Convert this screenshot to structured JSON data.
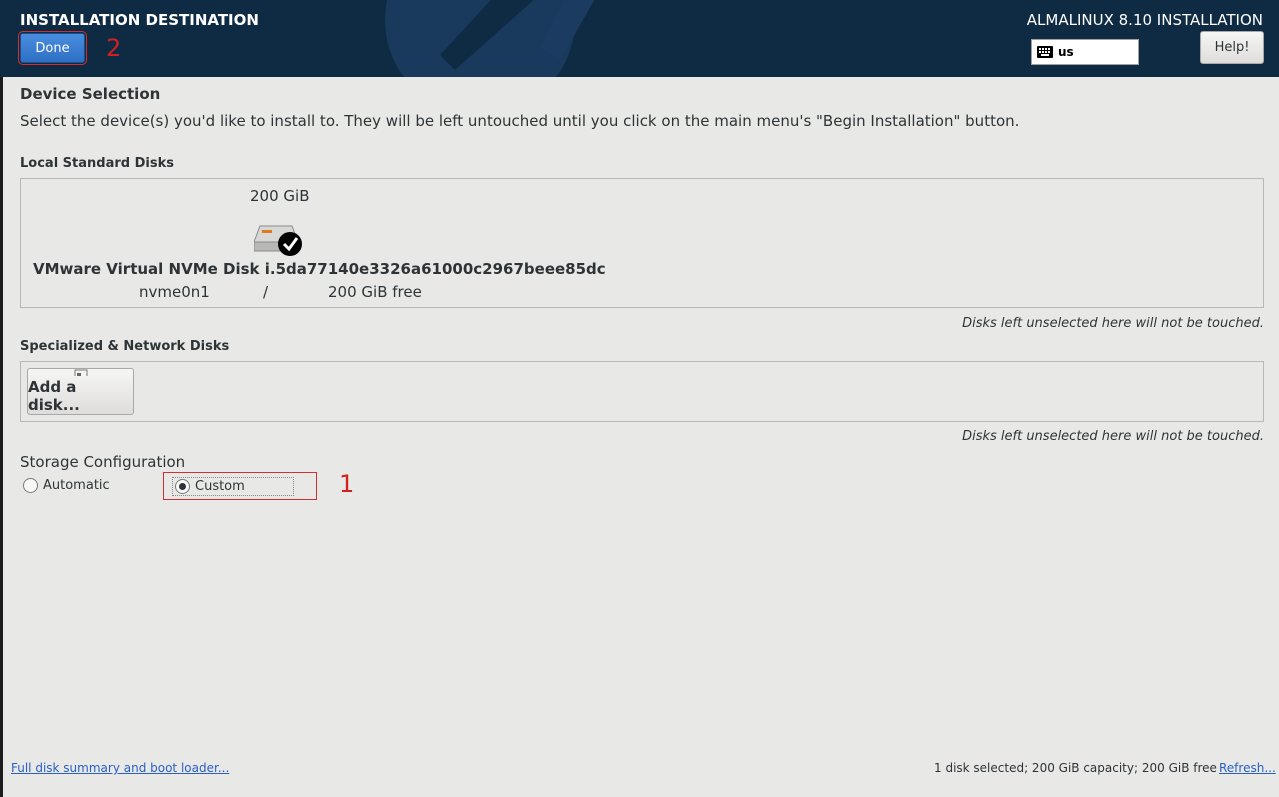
{
  "header": {
    "title": "INSTALLATION DESTINATION",
    "done_label": "Done",
    "product": "ALMALINUX 8.10 INSTALLATION",
    "keyboard_layout": "us",
    "help_label": "Help!"
  },
  "annotations": {
    "one": "1",
    "two": "2"
  },
  "device_selection": {
    "heading": "Device Selection",
    "description": "Select the device(s) you'd like to install to.  They will be left untouched until you click on the main menu's \"Begin Installation\" button."
  },
  "local_disks": {
    "heading": "Local Standard Disks",
    "disks": [
      {
        "capacity": "200 GiB",
        "name": "VMware Virtual NVMe Disk i.5da77140e3326a61000c2967beee85dc",
        "device": "nvme0n1",
        "separator": "/",
        "free": "200 GiB free",
        "selected": true
      }
    ],
    "note": "Disks left unselected here will not be touched."
  },
  "network_disks": {
    "heading": "Specialized & Network Disks",
    "add_label": "Add a disk...",
    "note": "Disks left unselected here will not be touched."
  },
  "storage_config": {
    "heading": "Storage Configuration",
    "options": [
      {
        "label": "Automatic",
        "selected": false
      },
      {
        "label": "Custom",
        "selected": true
      }
    ]
  },
  "footer": {
    "summary_link": "Full disk summary and boot loader...",
    "status": "1 disk selected; 200 GiB capacity; 200 GiB free",
    "refresh_link": "Refresh..."
  },
  "colors": {
    "header_bg": "#0f2b44",
    "done_button": "#3a7fd5",
    "annotation": "#d02020",
    "link": "#2a5fc4"
  },
  "icons": [
    "keyboard-icon",
    "disk-selected-icon",
    "add-disk-icon"
  ]
}
